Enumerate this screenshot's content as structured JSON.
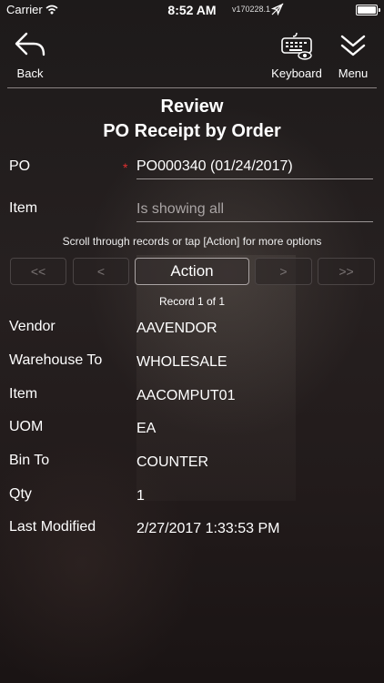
{
  "status_bar": {
    "carrier": "Carrier",
    "time": "8:52 AM",
    "version": "v170228.1"
  },
  "nav": {
    "back_label": "Back",
    "keyboard_label": "Keyboard",
    "menu_label": "Menu"
  },
  "title": {
    "line1": "Review",
    "line2": "PO Receipt by Order"
  },
  "form": {
    "po_label": "PO",
    "po_required": "*",
    "po_value": "PO000340 (01/24/2017)",
    "item_label": "Item",
    "item_placeholder": "Is showing all"
  },
  "hint": "Scroll through records or tap [Action] for more options",
  "pager": {
    "first": "<<",
    "prev": "<",
    "action": "Action",
    "next": ">",
    "last": ">>"
  },
  "record_info": "Record 1 of 1",
  "details": [
    {
      "label": "Vendor",
      "value": "AAVENDOR"
    },
    {
      "label": "Warehouse To",
      "value": "WHOLESALE"
    },
    {
      "label": "Item",
      "value": "AACOMPUT01"
    },
    {
      "label": "UOM",
      "value": "EA"
    },
    {
      "label": "Bin To",
      "value": "COUNTER"
    },
    {
      "label": "Qty",
      "value": "1"
    },
    {
      "label": "Last Modified",
      "value": "2/27/2017 1:33:53 PM"
    }
  ],
  "icons": {
    "back": "back-arrow-icon",
    "keyboard": "keyboard-icon",
    "menu": "chevron-down-icon"
  },
  "colors": {
    "required": "#e03030",
    "text": "#ffffff",
    "muted": "#a9a4a4"
  }
}
